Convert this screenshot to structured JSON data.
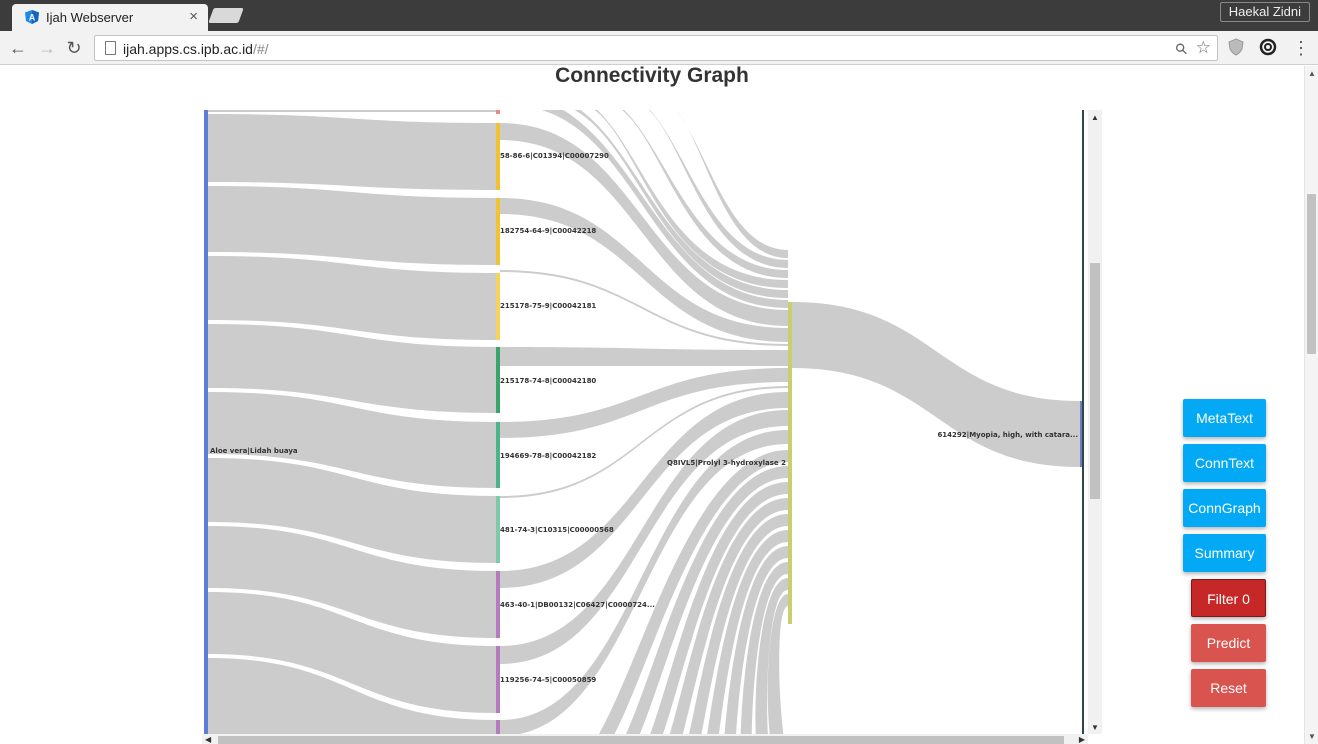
{
  "browser": {
    "tab_title": "Ijah Webserver",
    "tab_close": "×",
    "profile_name": "Haekal Zidni",
    "url_host": "ijah.apps.cs.ipb.ac.id",
    "url_path": "/#/",
    "back": "←",
    "forward": "→",
    "reload": "↻",
    "zoom_icon": "⚲",
    "bookmark_star": "☆",
    "menu_dots": "⋮"
  },
  "page": {
    "title": "Connectivity Graph"
  },
  "graph": {
    "plant_node": "Aloe vera|Lidah buaya",
    "compound_nodes": [
      {
        "label": "58-86-6|C01394|C00007290",
        "color": "#f1c232"
      },
      {
        "label": "182754-64-9|C00042218",
        "color": "#f1c232"
      },
      {
        "label": "215178-75-9|C00042181",
        "color": "#f6d35a"
      },
      {
        "label": "215178-74-8|C00042180",
        "color": "#3aa46a"
      },
      {
        "label": "194669-78-8|C00042182",
        "color": "#4cb38a"
      },
      {
        "label": "481-74-3|C10315|C00000568",
        "color": "#7fc8a8"
      },
      {
        "label": "463-40-1|DB00132|C06427|C0000724...",
        "color": "#b57ac0"
      },
      {
        "label": "119256-74-5|C00050859",
        "color": "#b57ac0"
      }
    ],
    "protein_node": "Q8IVL5|Prolyl 3-hydroxylase 2",
    "disease_node": "614292|Myopia, high, with catara..."
  },
  "colors": {
    "link": "#cccccc",
    "plant_bar": "#5b7fd6",
    "protein_bar": "#c7cf6e",
    "disease_bar": "#6a7fc0",
    "button_blue": "#03a9f4",
    "button_red": "#d9534f",
    "button_darkred": "#c62828"
  },
  "buttons": {
    "metatext": "MetaText",
    "conntext": "ConnText",
    "conngraph": "ConnGraph",
    "summary": "Summary",
    "filter": "Filter 0",
    "predict": "Predict",
    "reset": "Reset"
  }
}
